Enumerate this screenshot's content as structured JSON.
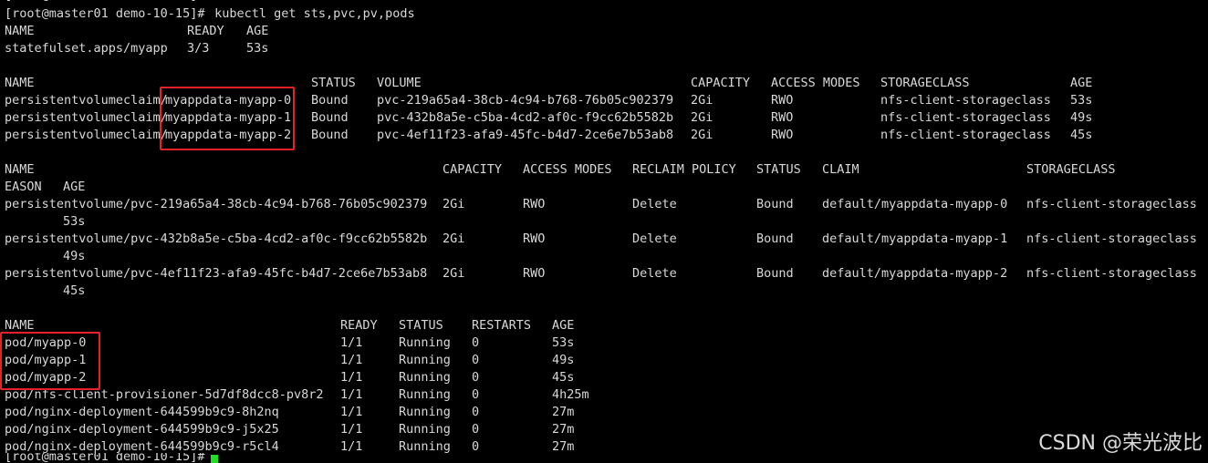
{
  "terminal": {
    "top_partial": "[root@master01 demo-10-15]#",
    "prompt": "[root@master01 demo-10-15]#",
    "command": " kubectl get sts,pvc,pv,pods",
    "bottom_prompt": "[root@master01 demo-10-15]#",
    "cursor_color": "#21e021"
  },
  "sts": {
    "headers": [
      "NAME",
      "READY",
      "AGE"
    ],
    "rows": [
      [
        "statefulset.apps/myapp",
        "3/3",
        "53s"
      ]
    ]
  },
  "pvc": {
    "headers": [
      "NAME",
      "STATUS",
      "VOLUME",
      "CAPACITY",
      "ACCESS MODES",
      "STORAGECLASS",
      "AGE"
    ],
    "rows": [
      [
        "persistentvolumeclaim/",
        "myappdata-myapp-0",
        "Bound",
        "pvc-219a65a4-38cb-4c94-b768-76b05c902379",
        "2Gi",
        "RWO",
        "nfs-client-storageclass",
        "53s"
      ],
      [
        "persistentvolumeclaim/",
        "myappdata-myapp-1",
        "Bound",
        "pvc-432b8a5e-c5ba-4cd2-af0c-f9cc62b5582b",
        "2Gi",
        "RWO",
        "nfs-client-storageclass",
        "49s"
      ],
      [
        "persistentvolumeclaim/",
        "myappdata-myapp-2",
        "Bound",
        "pvc-4ef11f23-afa9-45fc-b4d7-2ce6e7b53ab8",
        "2Gi",
        "RWO",
        "nfs-client-storageclass",
        "45s"
      ]
    ]
  },
  "pv": {
    "headers": [
      "NAME",
      "CAPACITY",
      "ACCESS MODES",
      "RECLAIM POLICY",
      "STATUS",
      "CLAIM",
      "STORAGECLASS"
    ],
    "wrap_header": [
      "EASON",
      "AGE"
    ],
    "rows": [
      [
        "persistentvolume/pvc-219a65a4-38cb-4c94-b768-76b05c902379",
        "2Gi",
        "RWO",
        "Delete",
        "Bound",
        "default/myappdata-myapp-0",
        "nfs-client-storageclass",
        "53s"
      ],
      [
        "persistentvolume/pvc-432b8a5e-c5ba-4cd2-af0c-f9cc62b5582b",
        "2Gi",
        "RWO",
        "Delete",
        "Bound",
        "default/myappdata-myapp-1",
        "nfs-client-storageclass",
        "49s"
      ],
      [
        "persistentvolume/pvc-4ef11f23-afa9-45fc-b4d7-2ce6e7b53ab8",
        "2Gi",
        "RWO",
        "Delete",
        "Bound",
        "default/myappdata-myapp-2",
        "nfs-client-storageclass",
        "45s"
      ]
    ]
  },
  "pods": {
    "headers": [
      "NAME",
      "READY",
      "STATUS",
      "RESTARTS",
      "AGE"
    ],
    "rows": [
      [
        "pod/myapp-0",
        "1/1",
        "Running",
        "0",
        "53s"
      ],
      [
        "pod/myapp-1",
        "1/1",
        "Running",
        "0",
        "49s"
      ],
      [
        "pod/myapp-2",
        "1/1",
        "Running",
        "0",
        "45s"
      ],
      [
        "pod/nfs-client-provisioner-5d7df8dcc8-pv8r2",
        "1/1",
        "Running",
        "0",
        "4h25m"
      ],
      [
        "pod/nginx-deployment-644599b9c9-8h2nq",
        "1/1",
        "Running",
        "0",
        "27m"
      ],
      [
        "pod/nginx-deployment-644599b9c9-j5x25",
        "1/1",
        "Running",
        "0",
        "27m"
      ],
      [
        "pod/nginx-deployment-644599b9c9-r5cl4",
        "1/1",
        "Running",
        "0",
        "27m"
      ]
    ]
  },
  "highlight_color": "#e5222a",
  "watermark": "CSDN @荣光波比"
}
